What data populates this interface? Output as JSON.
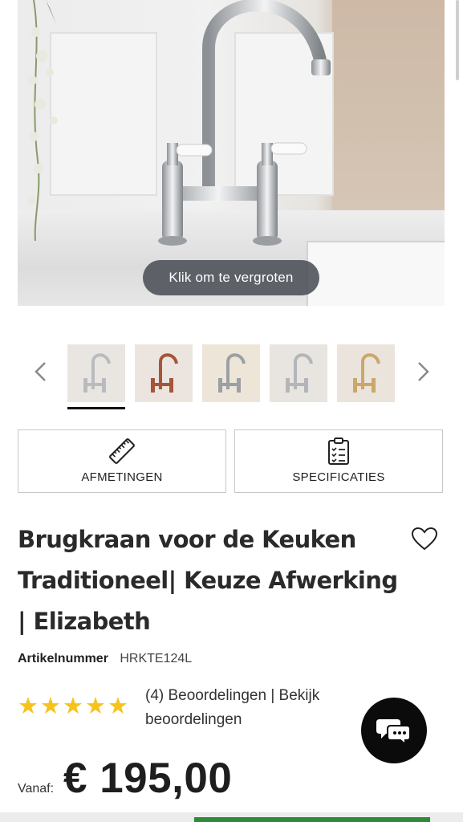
{
  "hero": {
    "zoom_label": "Klik om te vergroten"
  },
  "gallery": {
    "thumbnails": [
      {
        "name": "chrome",
        "bg": "#e9e6e2",
        "faucet": "#b9bcbf"
      },
      {
        "name": "copper",
        "bg": "#ece5df",
        "faucet": "#a5553a"
      },
      {
        "name": "chrome-beige",
        "bg": "#ede6d8",
        "faucet": "#9aa0a4"
      },
      {
        "name": "chrome-2",
        "bg": "#e8e4df",
        "faucet": "#b3b6b9"
      },
      {
        "name": "brass",
        "bg": "#ebe4dc",
        "faucet": "#c9a86a"
      }
    ]
  },
  "actions": {
    "dimensions_label": "AFMETINGEN",
    "specs_label": "SPECIFICATIES"
  },
  "product": {
    "title": "Brugkraan voor de Keuken Traditioneel| Keuze Afwerking | Elizabeth",
    "sku_label": "Artikelnummer",
    "sku_value": "HRKTE124L",
    "rating": 5,
    "reviews_text": "(4) Beoordelingen |  Bekijk beoordelingen",
    "price_prefix": "Vanaf:",
    "price": "€ 195,00"
  },
  "colors": {
    "accent_green": "#2e8b3a",
    "star": "#f6c21c"
  }
}
